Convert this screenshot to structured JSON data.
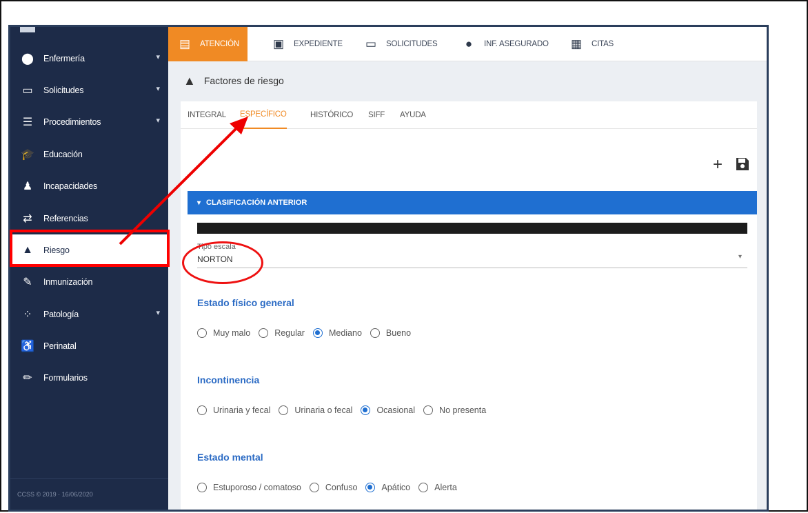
{
  "sidebar": {
    "items": [
      {
        "label": "Enfermería",
        "icon": "location-pin-icon",
        "glyph": "⬤",
        "has_chevron": true
      },
      {
        "label": "Solicitudes",
        "icon": "inbox-icon",
        "glyph": "▭",
        "has_chevron": true
      },
      {
        "label": "Procedimientos",
        "icon": "list-icon",
        "glyph": "☰",
        "has_chevron": true
      },
      {
        "label": "Educación",
        "icon": "graduation-cap-icon",
        "glyph": "🎓",
        "has_chevron": false
      },
      {
        "label": "Incapacidades",
        "icon": "person-icon",
        "glyph": "♟",
        "has_chevron": false
      },
      {
        "label": "Referencias",
        "icon": "swap-arrows-icon",
        "glyph": "⇄",
        "has_chevron": false
      },
      {
        "label": "Riesgo",
        "icon": "warning-icon",
        "glyph": "▲",
        "has_chevron": false,
        "active": true
      },
      {
        "label": "Inmunización",
        "icon": "syringe-icon",
        "glyph": "✎",
        "has_chevron": false
      },
      {
        "label": "Patología",
        "icon": "molecule-icon",
        "glyph": "⁘",
        "has_chevron": true
      },
      {
        "label": "Perinatal",
        "icon": "stroller-icon",
        "glyph": "♿",
        "has_chevron": false
      },
      {
        "label": "Formularios",
        "icon": "pencil-icon",
        "glyph": "✏",
        "has_chevron": false
      }
    ],
    "footer": "CCSS © 2019 · 16/06/2020"
  },
  "topnav": {
    "tabs": [
      {
        "label": "ATENCIÓN",
        "icon": "form-icon",
        "glyph": "▤",
        "active": true
      },
      {
        "label": "EXPEDIENTE",
        "icon": "folder-id-icon",
        "glyph": "▣"
      },
      {
        "label": "SOLICITUDES",
        "icon": "inbox-icon",
        "glyph": "▭"
      },
      {
        "label": "INF. ASEGURADO",
        "icon": "person-icon",
        "glyph": "●"
      },
      {
        "label": "CITAS",
        "icon": "calendar-icon",
        "glyph": "▦"
      }
    ]
  },
  "page": {
    "title": "Factores de riesgo",
    "title_icon": "warning-icon"
  },
  "subtabs": [
    "INTEGRAL",
    "ESPECÍFICO",
    "HISTÓRICO",
    "SIFF",
    "AYUDA"
  ],
  "active_subtab": "ESPECÍFICO",
  "actions": {
    "add": "+",
    "save": "💾"
  },
  "section": {
    "label": "CLASIFICACIÓN ANTERIOR"
  },
  "scale_field": {
    "label": "Tipo escala",
    "value": "NORTON"
  },
  "groups": [
    {
      "title": "Estado físico general",
      "options": [
        "Muy malo",
        "Regular",
        "Mediano",
        "Bueno"
      ],
      "selected": "Mediano"
    },
    {
      "title": "Incontinencia",
      "options": [
        "Urinaria y fecal",
        "Urinaria o fecal",
        "Ocasional",
        "No presenta"
      ],
      "selected": "Ocasional"
    },
    {
      "title": "Estado mental",
      "options": [
        "Estuporoso / comatoso",
        "Confuso",
        "Apático",
        "Alerta"
      ],
      "selected": "Apático"
    }
  ],
  "colors": {
    "sidebar_bg": "#1d2b48",
    "accent_orange": "#f08a24",
    "section_blue": "#1f6fd1",
    "annotation_red": "#ff0000"
  }
}
